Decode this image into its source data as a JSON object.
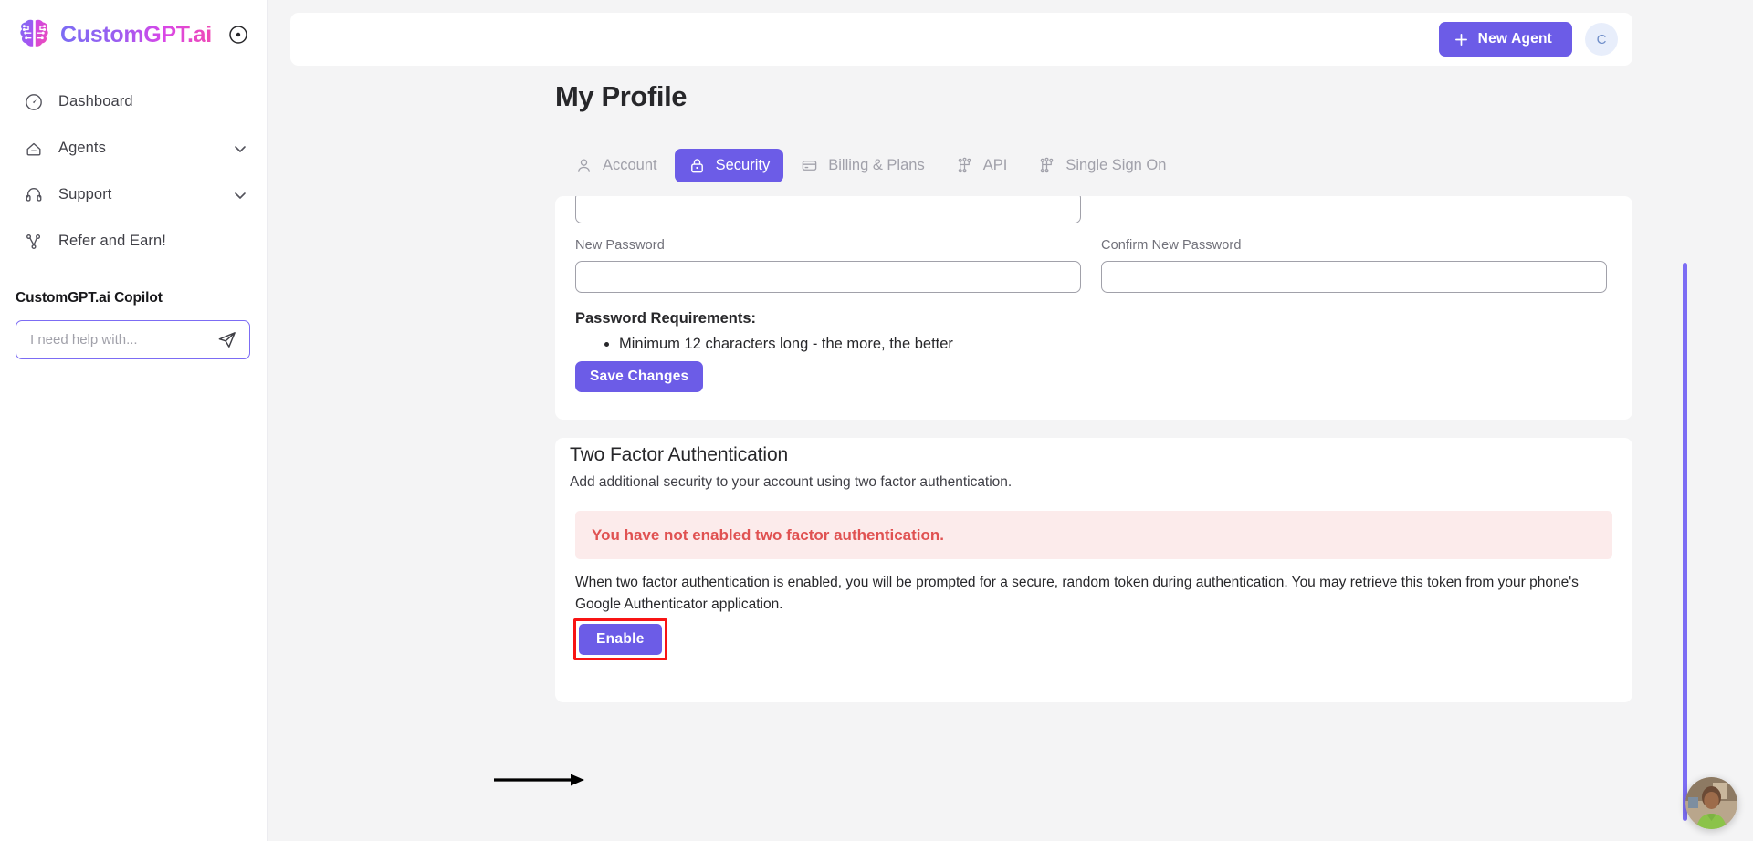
{
  "sidebar": {
    "brand": {
      "name": "CustomGPT.ai",
      "logo_icon": "brain-logo-icon",
      "collapse_icon": "collapse-circle-icon"
    },
    "items": [
      {
        "label": "Dashboard",
        "icon": "gauge-icon",
        "expandable": false
      },
      {
        "label": "Agents",
        "icon": "home-agent-icon",
        "expandable": true
      },
      {
        "label": "Support",
        "icon": "headset-icon",
        "expandable": true
      },
      {
        "label": "Refer and Earn!",
        "icon": "share-nodes-icon",
        "expandable": false
      }
    ],
    "copilot": {
      "title": "CustomGPT.ai Copilot",
      "placeholder": "I need help with...",
      "value": "",
      "send_icon": "paper-plane-icon"
    }
  },
  "topbar": {
    "new_agent_label": "New Agent",
    "plus_icon": "plus-icon",
    "avatar_initial": "C"
  },
  "page": {
    "title": "My Profile"
  },
  "tabs": [
    {
      "label": "Account",
      "icon": "user-icon",
      "active": false
    },
    {
      "label": "Security",
      "icon": "lock-icon",
      "active": true
    },
    {
      "label": "Billing & Plans",
      "icon": "credit-card-icon",
      "active": false
    },
    {
      "label": "API",
      "icon": "nodes-icon",
      "active": false
    },
    {
      "label": "Single Sign On",
      "icon": "nodes-icon",
      "active": false
    }
  ],
  "password_card": {
    "current_password_value": "",
    "new_password_label": "New Password",
    "new_password_value": "",
    "confirm_password_label": "Confirm New Password",
    "confirm_password_value": "",
    "requirements_title": "Password Requirements:",
    "requirements": [
      "Minimum 12 characters long - the more, the better"
    ],
    "save_label": "Save Changes"
  },
  "tfa_card": {
    "title": "Two Factor Authentication",
    "subtitle": "Add additional security to your account using two factor authentication.",
    "alert_text": "You have not enabled two factor authentication.",
    "description": "When two factor authentication is enabled, you will be prompted for a secure, random token during authentication. You may retrieve this token from your phone's Google Authenticator application.",
    "enable_label": "Enable"
  },
  "annotation": {
    "highlight_color": "#f81414",
    "arrow_icon": "arrow-right-annotation"
  },
  "colors": {
    "accent": "#6c5ce7",
    "accent_light": "#7c6cf4",
    "alert_bg": "#fcebeb",
    "alert_text": "#e05252",
    "page_bg": "#f4f4f5"
  },
  "chat_widget": {
    "icon": "support-agent-avatar"
  }
}
